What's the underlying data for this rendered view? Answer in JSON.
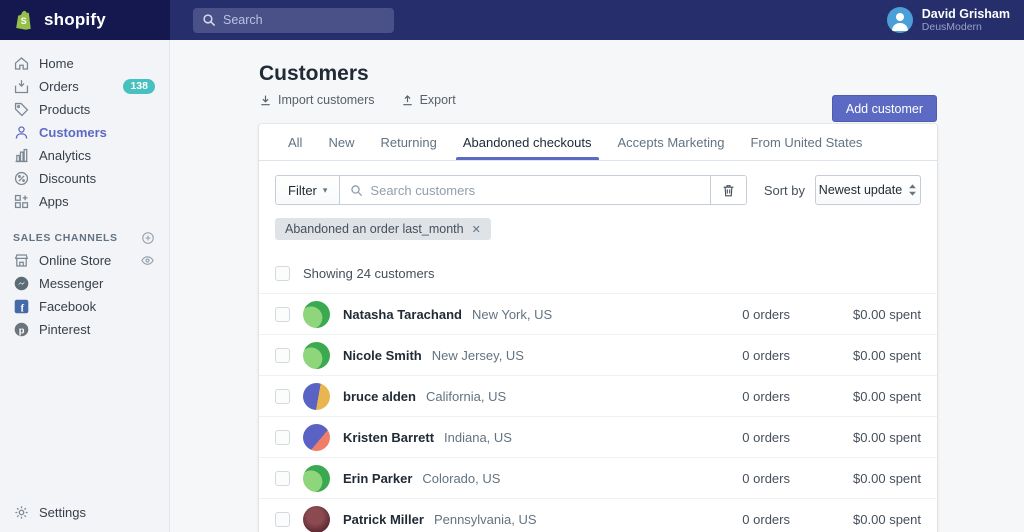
{
  "topbar": {
    "logo_text": "shopify",
    "search_placeholder": "Search",
    "user_name": "David Grisham",
    "user_store": "DeusModern"
  },
  "sidebar": {
    "items": [
      {
        "label": "Home"
      },
      {
        "label": "Orders",
        "badge": "138"
      },
      {
        "label": "Products"
      },
      {
        "label": "Customers"
      },
      {
        "label": "Analytics"
      },
      {
        "label": "Discounts"
      },
      {
        "label": "Apps"
      }
    ],
    "sales_channels_heading": "SALES CHANNELS",
    "channels": [
      {
        "label": "Online Store"
      },
      {
        "label": "Messenger"
      },
      {
        "label": "Facebook"
      },
      {
        "label": "Pinterest"
      }
    ],
    "settings_label": "Settings"
  },
  "header": {
    "title": "Customers",
    "import_label": "Import customers",
    "export_label": "Export",
    "add_button_label": "Add customer"
  },
  "tabs": [
    "All",
    "New",
    "Returning",
    "Abandoned checkouts",
    "Accepts Marketing",
    "From United States"
  ],
  "active_tab": "Abandoned checkouts",
  "filters": {
    "filter_button_label": "Filter",
    "search_placeholder": "Search customers",
    "sort_by_label": "Sort by",
    "sort_value": "Newest update",
    "applied_tag": "Abandoned an order last_month",
    "tag_close_glyph": "✕"
  },
  "list": {
    "summary": "Showing 24 customers",
    "rows": [
      {
        "name": "Natasha Tarachand",
        "location": "New York, US",
        "orders": "0 orders",
        "spent": "$0.00 spent",
        "avatar_css": "radial-gradient(circle at 30% 62%, #8fd57b 0 44%, #3aa950 45%)"
      },
      {
        "name": "Nicole Smith",
        "location": "New Jersey, US",
        "orders": "0 orders",
        "spent": "$0.00 spent",
        "avatar_css": "radial-gradient(circle at 30% 62%, #8fd57b 0 44%, #3aa950 45%)"
      },
      {
        "name": "bruce alden",
        "location": "California, US",
        "orders": "0 orders",
        "spent": "$0.00 spent",
        "avatar_css": "linear-gradient(100deg, #5a63c3 0 56%, #e8b54e 56%)"
      },
      {
        "name": "Kristen Barrett",
        "location": "Indiana, US",
        "orders": "0 orders",
        "spent": "$0.00 spent",
        "avatar_css": "linear-gradient(130deg, #5a63c3 0 60%, #ee7e68 60%)"
      },
      {
        "name": "Erin Parker",
        "location": "Colorado, US",
        "orders": "0 orders",
        "spent": "$0.00 spent",
        "avatar_css": "radial-gradient(circle at 30% 62%, #8fd57b 0 44%, #3aa950 45%)"
      },
      {
        "name": "Patrick Miller",
        "location": "Pennsylvania, US",
        "orders": "0 orders",
        "spent": "$0.00 spent",
        "avatar_css": "radial-gradient(circle at 45% 38%, #8a4a50 0 35%, #53222b 80%)"
      }
    ]
  },
  "icons": {
    "topbar_search": "magnifier",
    "import": "arrow-down-to-line",
    "export": "arrow-up-from-line",
    "trash": "trash-can",
    "sort": "up-down-arrows",
    "add_channel": "circled-plus",
    "online_store_visibility": "eye"
  },
  "colors": {
    "accent_indigo": "#5c6ac4",
    "badge_teal": "#47c1bf",
    "topbar_left": "#14184f",
    "topbar_main": "#262e6b",
    "facebook_blue": "#4469a8",
    "logo_green": "#95bf47"
  }
}
